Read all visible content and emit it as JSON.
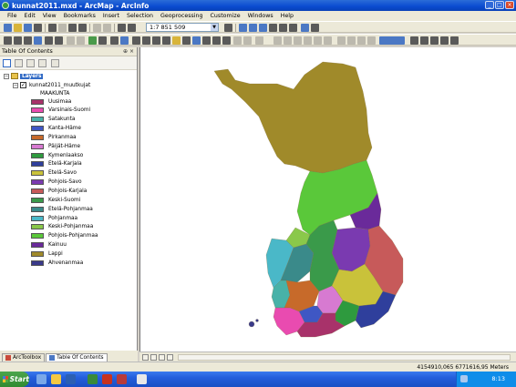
{
  "window": {
    "title": "kunnat2011.mxd - ArcMap - ArcInfo",
    "buttons": [
      "_",
      "□",
      "×"
    ]
  },
  "menu": [
    "File",
    "Edit",
    "View",
    "Bookmarks",
    "Insert",
    "Selection",
    "Geoprocessing",
    "Customize",
    "Windows",
    "Help"
  ],
  "toolbar": {
    "scale": "1:7 851 509"
  },
  "toc": {
    "title": "Table Of Contents",
    "header_controls": "⊕ ×",
    "root_label": "Layers",
    "layer_name": "kunnat2011_muutkujat",
    "field_name": "MAAKUNTA",
    "classes": [
      {
        "label": "Uusimaa",
        "color": "#a8326a"
      },
      {
        "label": "Varsinais-Suomi",
        "color": "#e94bb0"
      },
      {
        "label": "Satakunta",
        "color": "#48b2a8"
      },
      {
        "label": "Kanta-Häme",
        "color": "#3f57c4"
      },
      {
        "label": "Pirkanmaa",
        "color": "#c76a2a"
      },
      {
        "label": "Päijät-Häme",
        "color": "#d77ad1"
      },
      {
        "label": "Kymenlaakso",
        "color": "#2e9a3e"
      },
      {
        "label": "Etelä-Karjala",
        "color": "#2f3f9c"
      },
      {
        "label": "Etelä-Savo",
        "color": "#c9c23a"
      },
      {
        "label": "Pohjois-Savo",
        "color": "#7a3ab0"
      },
      {
        "label": "Pohjois-Karjala",
        "color": "#c75a5a"
      },
      {
        "label": "Keski-Suomi",
        "color": "#3a9a4a"
      },
      {
        "label": "Etelä-Pohjanmaa",
        "color": "#3a8a8a"
      },
      {
        "label": "Pohjanmaa",
        "color": "#4ab8c8"
      },
      {
        "label": "Keski-Pohjanmaa",
        "color": "#8ac84a"
      },
      {
        "label": "Pohjois-Pohjanmaa",
        "color": "#5ac83a"
      },
      {
        "label": "Kainuu",
        "color": "#6a2a9a"
      },
      {
        "label": "Lappi",
        "color": "#a08a2a"
      },
      {
        "label": "Ahvenanmaa",
        "color": "#3a3a8a"
      }
    ],
    "tabs": [
      "ArcToolbox",
      "Table Of Contents"
    ]
  },
  "status": {
    "coords": "4154910,065  6771616,95 Meters"
  },
  "taskbar": {
    "start_label": "Start",
    "clock": "8:13"
  }
}
